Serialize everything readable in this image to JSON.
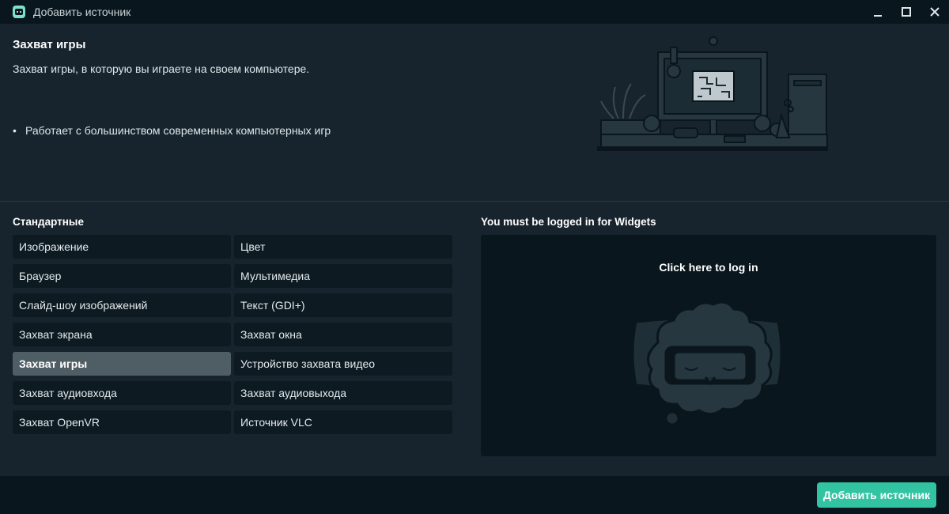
{
  "window": {
    "title": "Добавить источник",
    "icon": "streamlabs-icon",
    "controls": [
      "minimize-icon",
      "maximize-icon",
      "close-icon"
    ]
  },
  "header": {
    "title": "Захват игры",
    "description": "Захват игры, в которую вы играете на своем компьютере.",
    "features": [
      "Работает с большинством современных компьютерных игр"
    ],
    "bullet": "•"
  },
  "standard": {
    "title": "Стандартные",
    "items": [
      "Изображение",
      "Цвет",
      "Браузер",
      "Мультимедиа",
      "Слайд-шоу изображений",
      "Текст (GDI+)",
      "Захват экрана",
      "Захват окна",
      "Захват игры",
      "Устройство захвата видео",
      "Захват аудиовхода",
      "Захват аудиовыхода",
      "Захват OpenVR",
      "Источник VLC"
    ],
    "selected": "Захват игры"
  },
  "widgets": {
    "title": "You must be logged in for Widgets",
    "login_link": "Click here to log in"
  },
  "footer": {
    "add_button": "Добавить источник"
  },
  "colors": {
    "background": "#17242d",
    "titlebar": "#09161d",
    "item": "#0d1a22",
    "item_selected": "#4f5e65",
    "accent": "#31c3a2"
  }
}
